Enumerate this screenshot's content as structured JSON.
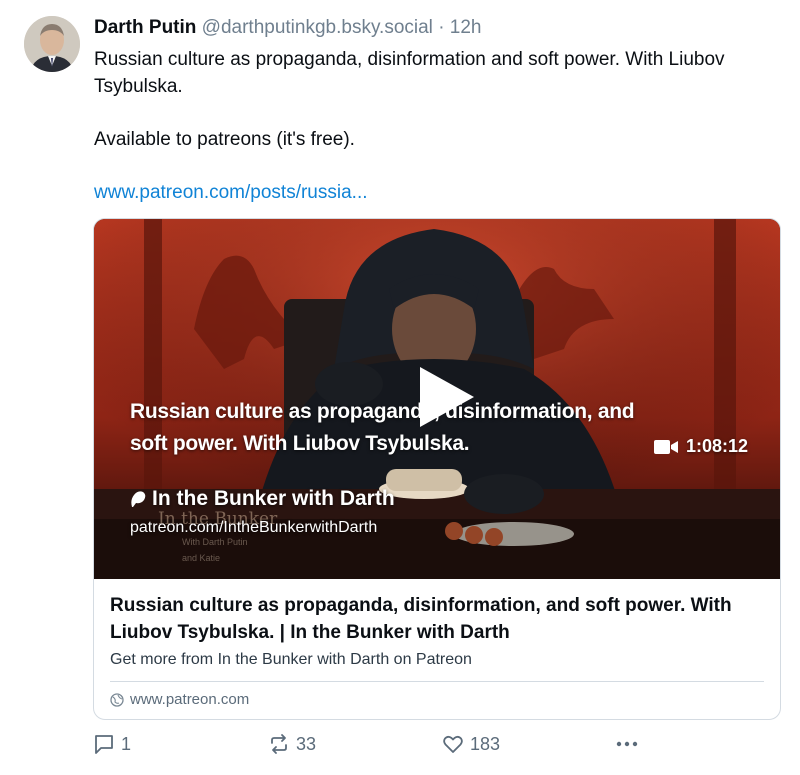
{
  "post": {
    "author_name": "Darth Putin",
    "author_handle": "@darthputinkgb.bsky.social",
    "separator": "·",
    "time": "12h",
    "text_line1": "Russian culture as propaganda, disinformation and soft power.  With Liubov Tsybulska.",
    "text_line2": "Available to patreons (it's free).",
    "link_text": "www.patreon.com/posts/russia..."
  },
  "embed": {
    "overlay_title": "Russian culture as propaganda, disinformation, and soft power. With Liubov Tsybulska.",
    "duration": "1:08:12",
    "creator_name": "In the Bunker with Darth",
    "creator_url": "patreon.com/IntheBunkerwithDarth",
    "background_book_title": "In the Bunker",
    "background_book_sub1": "With Darth Putin",
    "background_book_sub2": "and Katie",
    "title": "Russian culture as propaganda, disinformation, and soft power. With Liubov Tsybulska. | In the Bunker with Darth",
    "description": "Get more from In the Bunker with Darth  on Patreon",
    "domain": "www.patreon.com"
  },
  "actions": {
    "reply_count": "1",
    "repost_count": "33",
    "like_count": "183"
  },
  "icons": {
    "reply": "reply-icon",
    "repost": "repost-icon",
    "like": "heart-icon",
    "more": "more-icon",
    "globe": "globe-icon",
    "play": "play-icon",
    "video": "video-camera-icon",
    "patreon": "patreon-logo-icon"
  },
  "colors": {
    "link": "#1083d6",
    "muted": "#6f7f8e",
    "thumb_red": "#c23a22"
  }
}
